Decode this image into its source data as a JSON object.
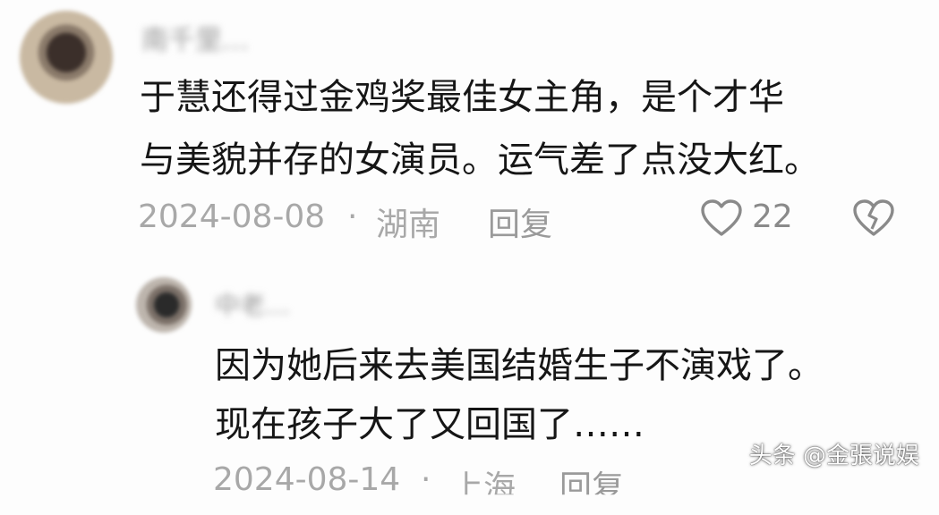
{
  "comment": {
    "username": "南千里…",
    "text_line1": "于慧还得过金鸡奖最佳女主角，是个才华",
    "text_line2": "与美貌并存的女演员。运气差了点没大红。",
    "date": "2024-08-08",
    "separator": "·",
    "location": "湖南",
    "reply_label": "回复",
    "like_count": "22",
    "icons": [
      "heart-icon",
      "broken-heart-icon"
    ]
  },
  "reply": {
    "username": "中老…",
    "text_line1": "因为她后来去美国结婚生子不演戏了。",
    "text_line2": "现在孩子大了又回国了……",
    "date": "2024-08-14",
    "separator": "·",
    "location": "上海",
    "reply_label": "回复"
  },
  "watermark": "头条 @金張说娱"
}
